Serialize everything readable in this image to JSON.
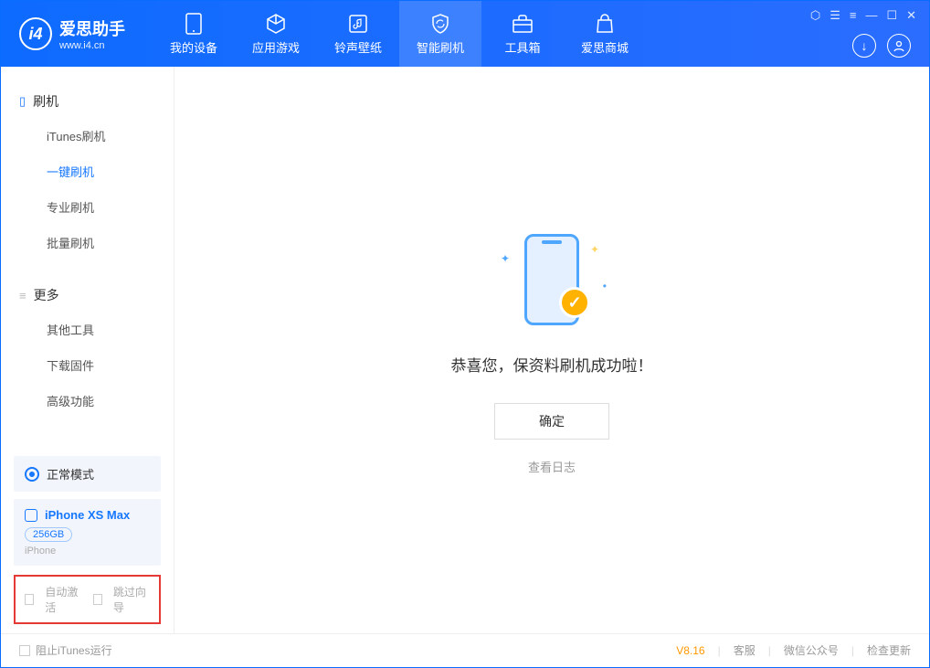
{
  "app": {
    "title": "爱思助手",
    "subtitle": "www.i4.cn"
  },
  "tabs": [
    {
      "label": "我的设备"
    },
    {
      "label": "应用游戏"
    },
    {
      "label": "铃声壁纸"
    },
    {
      "label": "智能刷机"
    },
    {
      "label": "工具箱"
    },
    {
      "label": "爱思商城"
    }
  ],
  "sidebar": {
    "section1": {
      "title": "刷机",
      "items": [
        "iTunes刷机",
        "一键刷机",
        "专业刷机",
        "批量刷机"
      ]
    },
    "section2": {
      "title": "更多",
      "items": [
        "其他工具",
        "下载固件",
        "高级功能"
      ]
    }
  },
  "status": {
    "mode": "正常模式"
  },
  "device": {
    "name": "iPhone XS Max",
    "storage": "256GB",
    "type": "iPhone"
  },
  "options": {
    "auto_activate": "自动激活",
    "skip_guide": "跳过向导"
  },
  "main": {
    "message": "恭喜您，保资料刷机成功啦！",
    "ok": "确定",
    "log_link": "查看日志"
  },
  "footer": {
    "block_itunes": "阻止iTunes运行",
    "version": "V8.16",
    "links": [
      "客服",
      "微信公众号",
      "检查更新"
    ]
  }
}
